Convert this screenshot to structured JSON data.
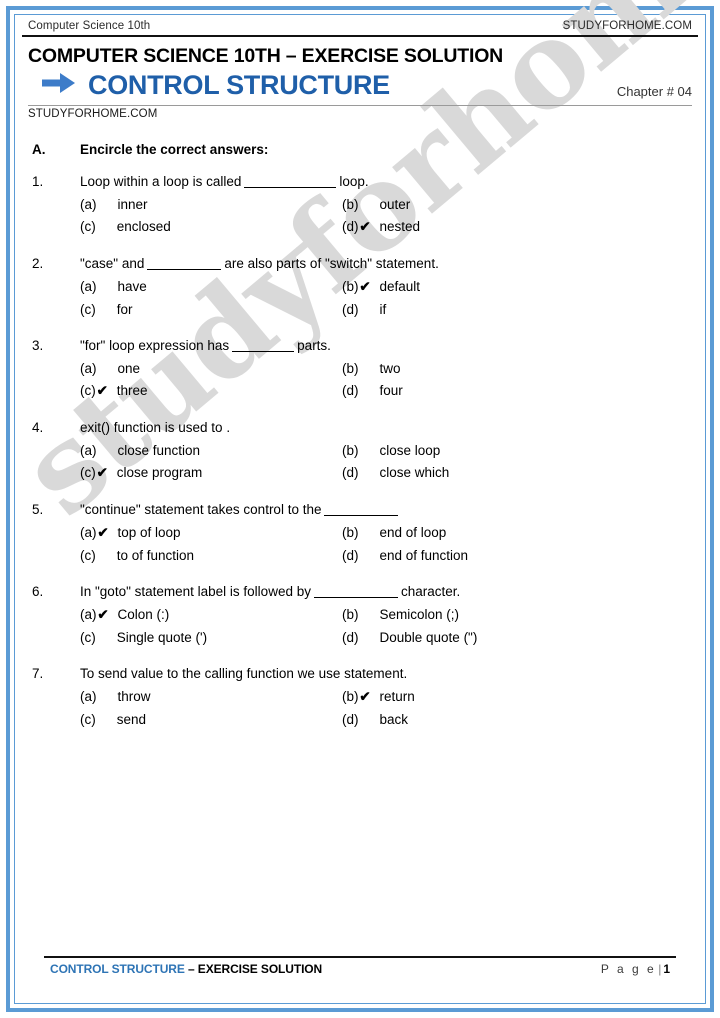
{
  "page": {
    "border_color": "#5B9BD5",
    "accent_blue": "#1F5FA9",
    "footer_blue": "#2E74B5",
    "watermark_text": "studyforhome.com"
  },
  "running_header": {
    "left": "Computer Science 10th",
    "right": "STUDYFORHOME.COM"
  },
  "title_block": {
    "doc_title": "COMPUTER SCIENCE 10TH – EXERCISE SOLUTION",
    "chapter_title": "CONTROL STRUCTURE",
    "chapter_number": "Chapter # 04",
    "site_line": "STUDYFORHOME.COM",
    "arrow_icon": "arrow-right-icon"
  },
  "section": {
    "letter": "A.",
    "heading": "Encircle the correct answers:"
  },
  "tick_glyph": "✔",
  "questions": [
    {
      "num": "1.",
      "text_before": "Loop within a loop is called",
      "blank_width": 92,
      "text_after": "loop.",
      "options": [
        {
          "key": "(a)",
          "label": "inner",
          "correct": false
        },
        {
          "key": "(b)",
          "label": "outer",
          "correct": false
        },
        {
          "key": "(c)",
          "label": "enclosed",
          "correct": false
        },
        {
          "key": "(d)",
          "label": "nested",
          "correct": true
        }
      ]
    },
    {
      "num": "2.",
      "text_before": "\"case\" and",
      "blank_width": 74,
      "text_after": "are also parts of \"switch\" statement.",
      "options": [
        {
          "key": "(a)",
          "label": "have",
          "correct": false
        },
        {
          "key": "(b)",
          "label": "default",
          "correct": true
        },
        {
          "key": "(c)",
          "label": "for",
          "correct": false
        },
        {
          "key": "(d)",
          "label": "if",
          "correct": false
        }
      ]
    },
    {
      "num": "3.",
      "text_before": "\"for\" loop expression has",
      "blank_width": 62,
      "text_after": "parts.",
      "options": [
        {
          "key": "(a)",
          "label": "one",
          "correct": false
        },
        {
          "key": "(b)",
          "label": "two",
          "correct": false
        },
        {
          "key": "(c)",
          "label": "three",
          "correct": true
        },
        {
          "key": "(d)",
          "label": "four",
          "correct": false
        }
      ]
    },
    {
      "num": "4.",
      "text_before": "exit() function is used to .",
      "blank_width": 0,
      "text_after": "",
      "options": [
        {
          "key": "(a)",
          "label": "close function",
          "correct": false
        },
        {
          "key": "(b)",
          "label": "close loop",
          "correct": false
        },
        {
          "key": "(c)",
          "label": "close program",
          "correct": true
        },
        {
          "key": "(d)",
          "label": "close which",
          "correct": false
        }
      ]
    },
    {
      "num": "5.",
      "text_before": "\"continue\" statement takes control to the",
      "blank_width": 74,
      "text_after": "",
      "options": [
        {
          "key": "(a)",
          "label": "top of loop",
          "correct": true
        },
        {
          "key": "(b)",
          "label": "end of loop",
          "correct": false
        },
        {
          "key": "(c)",
          "label": "to of function",
          "correct": false
        },
        {
          "key": "(d)",
          "label": "end of function",
          "correct": false
        }
      ]
    },
    {
      "num": "6.",
      "text_before": "In \"goto\" statement label is followed by",
      "blank_width": 84,
      "text_after": "character.",
      "options": [
        {
          "key": "(a)",
          "label": "Colon (:)",
          "correct": true
        },
        {
          "key": "(b)",
          "label": "Semicolon (;)",
          "correct": false
        },
        {
          "key": "(c)",
          "label": "Single quote (')",
          "correct": false
        },
        {
          "key": "(d)",
          "label": "Double quote (\")",
          "correct": false
        }
      ]
    },
    {
      "num": "7.",
      "text_before": "To send value to the calling function we use statement.",
      "blank_width": 0,
      "text_after": "",
      "options": [
        {
          "key": "(a)",
          "label": "throw",
          "correct": false
        },
        {
          "key": "(b)",
          "label": "return",
          "correct": true
        },
        {
          "key": "(c)",
          "label": "send",
          "correct": false
        },
        {
          "key": "(d)",
          "label": "back",
          "correct": false
        }
      ]
    }
  ],
  "footer": {
    "title_blue": "CONTROL STRUCTURE",
    "title_black": " – EXERCISE SOLUTION",
    "page_word": "P a g e",
    "page_sep": "|",
    "page_number": "1"
  }
}
